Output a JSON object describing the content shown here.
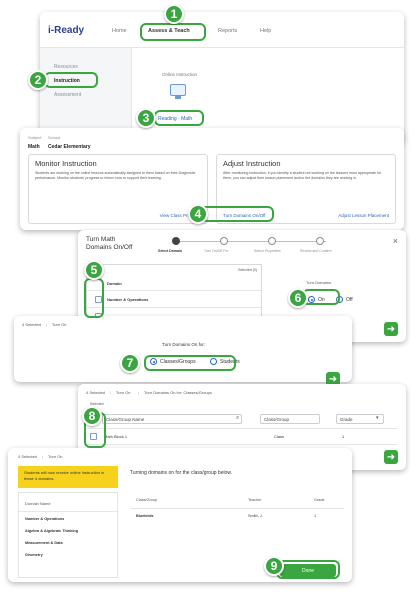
{
  "colors": {
    "accent_green": "#3aa640",
    "header_blue": "#2a3f8f",
    "link_blue": "#2a66b8",
    "notice_yellow": "#f6d21d"
  },
  "badges": [
    "1",
    "2",
    "3",
    "4",
    "5",
    "6",
    "7",
    "8",
    "9"
  ],
  "panel1": {
    "logo": "i-Ready",
    "nav": [
      "Home",
      "Assess & Teach",
      "Reports",
      "Help"
    ],
    "sidebar": [
      "Resources",
      "Instruction",
      "Assessment"
    ],
    "content_title": "Online Instruction",
    "reading_link": "Reading · Math",
    "icon": "monitor-icon"
  },
  "panel2": {
    "subject_label": "Subject",
    "school_label": "School",
    "subject": "Math",
    "school": "Cedar Elementary",
    "monitor": {
      "title": "Monitor Instruction",
      "body": "Students are working on the online lessons automatically assigned to them based on their Diagnostic performance. Monitor students' progress to inform how to support their learning.",
      "link": "View Class Progress"
    },
    "adjust": {
      "title": "Adjust Instruction",
      "body": "After monitoring instruction, if you identify a student not working on the lessons most appropriate for them, you can adjust their lesson placement and/or the domains they are working in.",
      "button": "Turn Domains On/Off",
      "link": "Adjust Lesson Placement"
    }
  },
  "panel3": {
    "title": "Turn Math Domains On/Off",
    "steps": [
      "Select Domain",
      "Turn On/Off For",
      "Select Properties",
      "Review and Confirm"
    ],
    "selected_label": "Selected (0)",
    "domain_header": "Domain",
    "domain_first": "Number & Operations",
    "turn_domains_label": "Turn Domains",
    "on_label": "On",
    "off_label": "Off",
    "close": "×"
  },
  "panel4": {
    "breadcrumb": [
      "4 Selected",
      "Turn On"
    ],
    "prompt": "Turn Domains On for:",
    "option1": "Classes/Groups",
    "option2": "Students"
  },
  "panel5": {
    "breadcrumb": [
      "4 Selected",
      "Turn On",
      "Turn Domains On for: Classes/Groups"
    ],
    "selected_label": "Selected",
    "filter1": "Class/Group Name",
    "filter2": "Class/Group",
    "filter3": "Grade",
    "row_name": "Math Block 1",
    "row_type": "Class",
    "row_grade": "1"
  },
  "panel6": {
    "breadcrumb": [
      "4 Selected",
      "Turn On"
    ],
    "notice": "Students will now receive online instruction in these 4 domains.",
    "heading": "Turning domains on for the class/group below.",
    "domains_header": "Domain Name",
    "domains": [
      "Number & Operations",
      "Algebra & Algebraic Thinking",
      "Measurement & Data",
      "Geometry"
    ],
    "table_headers": [
      "Class/Group",
      "Teacher",
      "Grade"
    ],
    "table_row": [
      "Bluebirds",
      "Smith, J.",
      "1"
    ],
    "done_button": "Done"
  }
}
